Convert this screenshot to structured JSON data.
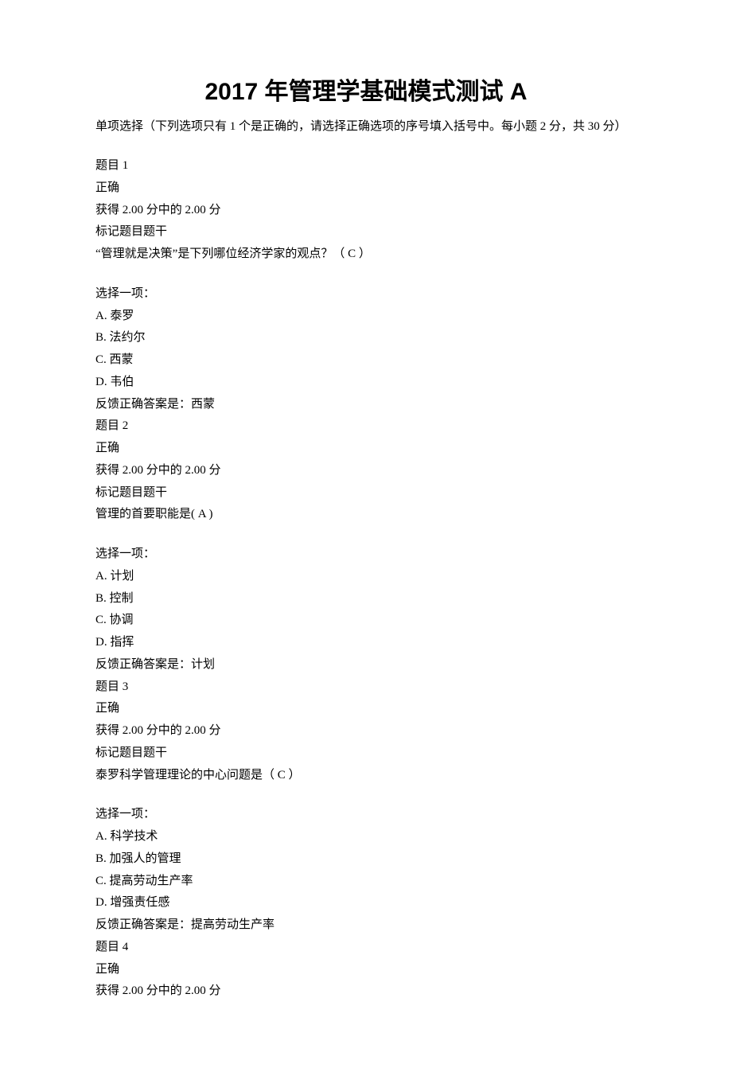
{
  "title": "2017 年管理学基础模式测试 A",
  "instructions": "单项选择（下列选项只有 1 个是正确的，请选择正确选项的序号填入括号中。每小题 2 分，共 30 分）",
  "labels": {
    "correct": "正确",
    "flag": " 标记题目题干",
    "select_one": "选择一项："
  },
  "q1": {
    "header": "题目 1",
    "score": "获得 2.00 分中的 2.00 分",
    "stem": "“管理就是决策”是下列哪位经济学家的观点？（ C ）",
    "optA": "A.  泰罗",
    "optB": "B.  法约尔",
    "optC": "C.  西蒙",
    "optD": "D.  韦伯",
    "feedback": "反馈正确答案是：西蒙"
  },
  "q2": {
    "header": "题目 2",
    "score": "获得 2.00 分中的 2.00 分",
    "stem": "管理的首要职能是( A     )",
    "optA": "A.  计划",
    "optB": "B.  控制",
    "optC": "C.  协调",
    "optD": "D.  指挥",
    "feedback": "反馈正确答案是：计划"
  },
  "q3": {
    "header": "题目 3",
    "score": "获得 2.00 分中的 2.00 分",
    "stem": "泰罗科学管理理论的中心问题是（ C    ）",
    "optA": "A.  科学技术",
    "optB": "B.  加强人的管理",
    "optC": "C.  提高劳动生产率",
    "optD": "D.  增强责任感",
    "feedback": "反馈正确答案是：提高劳动生产率"
  },
  "q4": {
    "header": "题目 4",
    "score": "获得 2.00 分中的 2.00 分"
  }
}
